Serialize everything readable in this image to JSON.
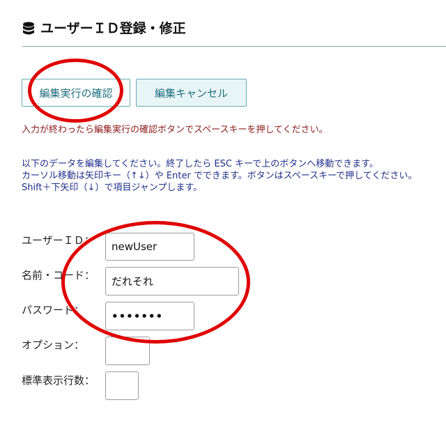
{
  "header": {
    "icon": "database-icon",
    "title": "ユーザーＩＤ登録・修正"
  },
  "toolbar": {
    "confirm_label": "編集実行の確認",
    "cancel_label": "編集キャンセル"
  },
  "hint_red": "入力が終わったら編集実行の確認ボタンでスペースキーを押してください。",
  "instructions": [
    "以下のデータを編集してください。終了したら ESC キーで上のボタンへ移動できます。",
    "カーソル移動は矢印キー（↑↓）や Enter でできます。ボタンはスペースキーで押してください。",
    "Shift＋下矢印（↓）で項目ジャンプします。"
  ],
  "form": {
    "user_id_label": "ユーザーＩＤ：",
    "user_id_value": "newUser",
    "name_code_label": "名前・コード：",
    "name_code_value": "だれそれ",
    "password_label": "パスワード：",
    "password_value": "•••••••",
    "option_label": "オプション：",
    "option_value": "",
    "rows_label": "標準表示行数：",
    "rows_value": ""
  },
  "colors": {
    "accent": "#1f6f7f",
    "annotation": "#e00000",
    "hint": "#8b1a1a",
    "instructions": "#1d2f8a"
  }
}
